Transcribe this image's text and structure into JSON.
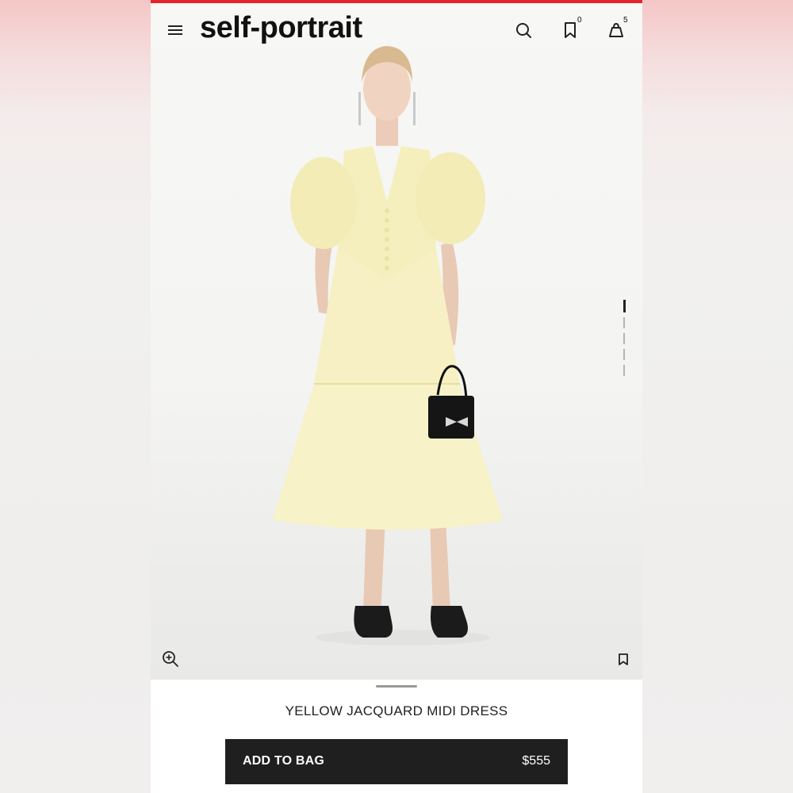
{
  "brand": {
    "logo_text": "self-portrait",
    "accent_color": "#e4242b"
  },
  "header": {
    "menu_icon": "hamburger-icon",
    "search_icon": "search-icon",
    "wishlist_icon": "bookmark-icon",
    "wishlist_count": "0",
    "bag_icon": "shopping-bag-icon",
    "bag_count": "5"
  },
  "gallery": {
    "zoom_icon": "zoom-in-icon",
    "save_icon": "bookmark-icon",
    "image_count": 5,
    "active_image": 1
  },
  "product": {
    "title": "YELLOW JACQUARD MIDI DRESS",
    "add_to_bag_label": "ADD TO BAG",
    "price": "$555",
    "button_color": "#1f1f1f"
  }
}
